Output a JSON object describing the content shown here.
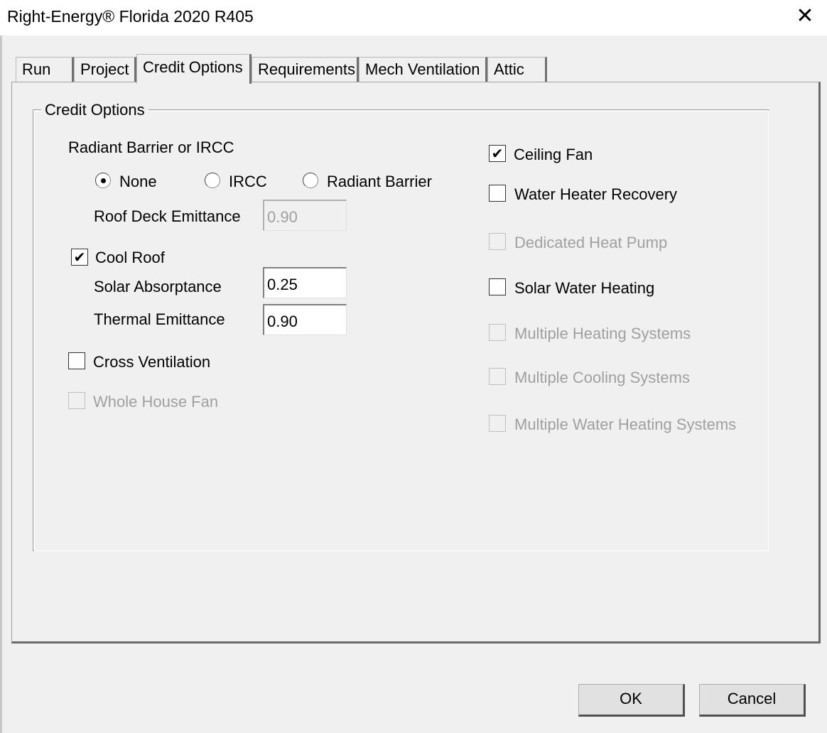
{
  "window": {
    "title": "Right-Energy® Florida 2020 R405",
    "close_glyph": "✕"
  },
  "tabs": [
    {
      "label": "Run",
      "active": false
    },
    {
      "label": "Project",
      "active": false
    },
    {
      "label": "Credit Options",
      "active": true
    },
    {
      "label": "Requirements",
      "active": false
    },
    {
      "label": "Mech Ventilation",
      "active": false
    },
    {
      "label": "Attic",
      "active": false
    }
  ],
  "group": {
    "title": "Credit Options"
  },
  "radiant": {
    "label": "Radiant Barrier or IRCC",
    "options": [
      {
        "label": "None",
        "selected": true
      },
      {
        "label": "IRCC",
        "selected": false
      },
      {
        "label": "Radiant Barrier",
        "selected": false
      }
    ],
    "roof_deck_label": "Roof Deck Emittance",
    "roof_deck_value": "0.90"
  },
  "cool_roof": {
    "label": "Cool Roof",
    "checked": true,
    "solar_label": "Solar Absorptance",
    "solar_value": "0.25",
    "thermal_label": "Thermal Emittance",
    "thermal_value": "0.90"
  },
  "left_checks": {
    "cross_ventilation": {
      "label": "Cross Ventilation",
      "checked": false,
      "enabled": true
    },
    "whole_house_fan": {
      "label": "Whole House Fan",
      "checked": false,
      "enabled": false
    }
  },
  "right_checks": {
    "ceiling_fan": {
      "label": "Ceiling Fan",
      "checked": true,
      "enabled": true
    },
    "water_heater_recovery": {
      "label": "Water Heater Recovery",
      "checked": false,
      "enabled": true
    },
    "dedicated_heat_pump": {
      "label": "Dedicated Heat Pump",
      "checked": false,
      "enabled": false
    },
    "solar_water_heating": {
      "label": "Solar Water Heating",
      "checked": false,
      "enabled": true
    },
    "multiple_heating": {
      "label": "Multiple Heating Systems",
      "checked": false,
      "enabled": false
    },
    "multiple_cooling": {
      "label": "Multiple Cooling Systems",
      "checked": false,
      "enabled": false
    },
    "multiple_water_heating": {
      "label": "Multiple Water Heating Systems",
      "checked": false,
      "enabled": false
    }
  },
  "check_glyph": "✔",
  "buttons": {
    "ok": "OK",
    "cancel": "Cancel"
  }
}
